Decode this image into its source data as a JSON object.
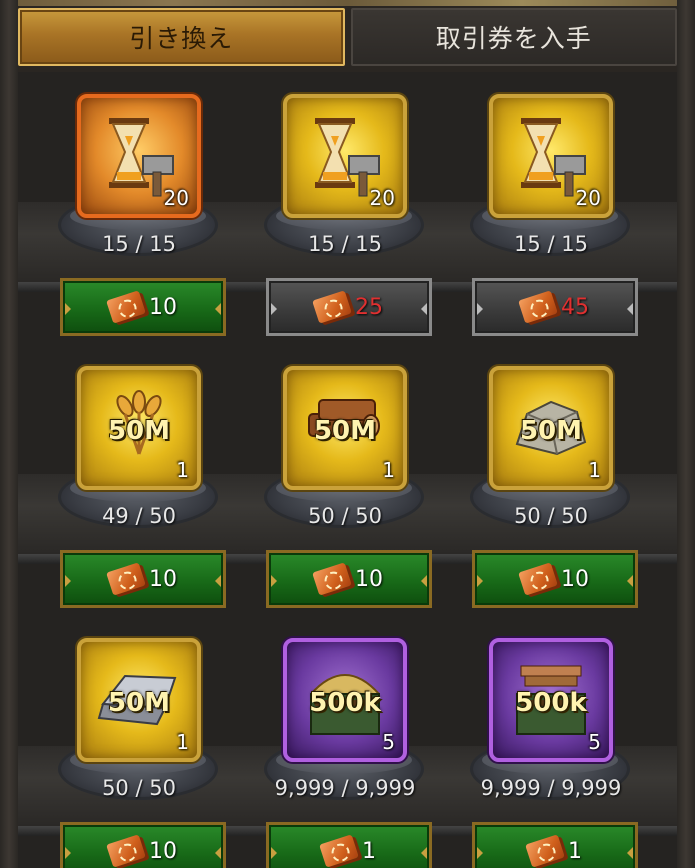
{
  "tabs": {
    "exchange": "引き換え",
    "get_tickets": "取引券を入手"
  },
  "items": [
    {
      "name": "build-speedup",
      "big_label": "",
      "qty": "20",
      "stock": "15 / 15",
      "price": "10",
      "price_state": "available",
      "frame": "orange",
      "icon": "hourglass-hammer-icon"
    },
    {
      "name": "build-speedup",
      "big_label": "",
      "qty": "20",
      "stock": "15 / 15",
      "price": "25",
      "price_state": "unavailable",
      "frame": "gold",
      "icon": "hourglass-hammer-icon"
    },
    {
      "name": "build-speedup",
      "big_label": "",
      "qty": "20",
      "stock": "15 / 15",
      "price": "45",
      "price_state": "unavailable",
      "frame": "gold",
      "icon": "hourglass-hammer-icon"
    },
    {
      "name": "food",
      "big_label": "50M",
      "qty": "1",
      "stock": "49 / 50",
      "price": "10",
      "price_state": "available",
      "frame": "gold",
      "icon": "wheat-icon"
    },
    {
      "name": "wood",
      "big_label": "50M",
      "qty": "1",
      "stock": "50 / 50",
      "price": "10",
      "price_state": "available",
      "frame": "gold",
      "icon": "logs-icon"
    },
    {
      "name": "stone",
      "big_label": "50M",
      "qty": "1",
      "stock": "50 / 50",
      "price": "10",
      "price_state": "available",
      "frame": "gold",
      "icon": "stone-icon"
    },
    {
      "name": "iron",
      "big_label": "50M",
      "qty": "1",
      "stock": "50 / 50",
      "price": "10",
      "price_state": "available",
      "frame": "gold",
      "icon": "iron-ingot-icon"
    },
    {
      "name": "food-crate",
      "big_label": "500k",
      "qty": "5",
      "stock": "9,999 / 9,999",
      "price": "1",
      "price_state": "available",
      "frame": "purple",
      "icon": "wheat-crate-icon"
    },
    {
      "name": "wood-crate",
      "big_label": "500k",
      "qty": "5",
      "stock": "9,999 / 9,999",
      "price": "1",
      "price_state": "available",
      "frame": "purple",
      "icon": "wood-crate-icon"
    }
  ]
}
